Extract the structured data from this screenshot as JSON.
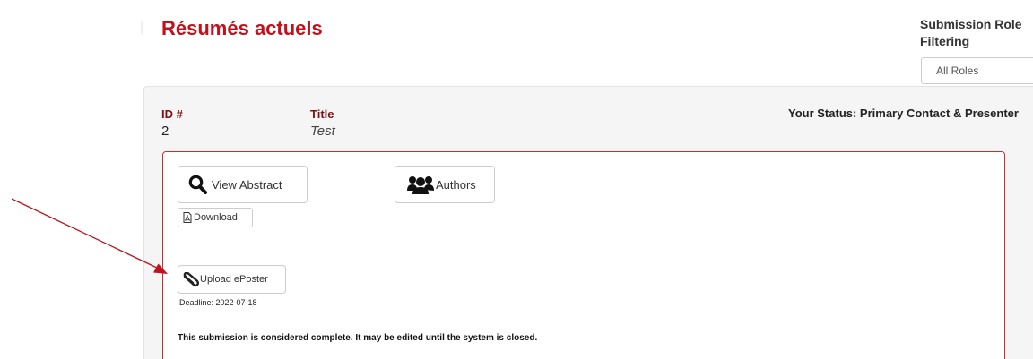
{
  "page": {
    "title": "Résumés actuels"
  },
  "role_filter": {
    "label": "Submission Role Filtering",
    "selected": "All Roles"
  },
  "abstract": {
    "id_label": "ID #",
    "id_value": "2",
    "title_label": "Title",
    "title_value": "Test",
    "status": "Your Status: Primary Contact & Presenter",
    "buttons": {
      "view_abstract": "View Abstract",
      "authors": "Authors",
      "download": "Download",
      "upload_eposter": "Upload ePoster"
    },
    "deadline": "Deadline: 2022-07-18",
    "completion_note": "This submission is considered complete. It may be edited until the system is closed."
  },
  "colors": {
    "title_red": "#c0121c",
    "label_maroon": "#7a1313",
    "panel_border": "#c9302c",
    "annotation_arrow": "#c0121c"
  },
  "icons": {
    "view_abstract": "magnifier-icon",
    "authors": "users-icon",
    "download": "pdf-file-icon",
    "upload_eposter": "paperclip-icon"
  }
}
